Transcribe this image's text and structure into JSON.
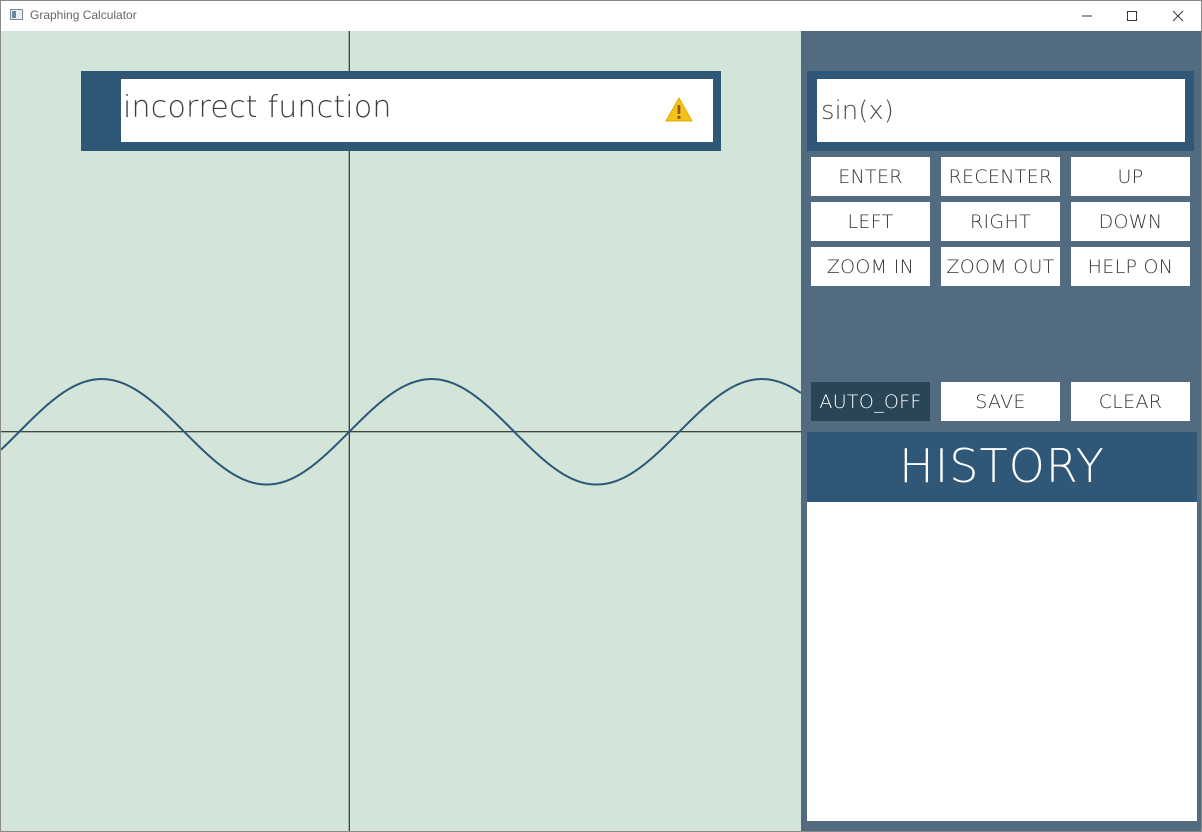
{
  "window": {
    "title": "Graphing Calculator",
    "controls": [
      "minimize",
      "maximize",
      "close"
    ]
  },
  "error": {
    "message": "incorrect function",
    "icon": "warning-icon"
  },
  "function_input": {
    "value": "sin(x)"
  },
  "buttons": {
    "enter": "ENTER",
    "recenter": "RECENTER",
    "up": "UP",
    "left": "LEFT",
    "right": "RIGHT",
    "down": "DOWN",
    "zoom_in": "ZOOM IN",
    "zoom_out": "ZOOM OUT",
    "help": "HELP ON",
    "auto": "AUTO_OFF",
    "save": "SAVE",
    "clear": "CLEAR"
  },
  "history": {
    "title": "HISTORY",
    "items": []
  },
  "colors": {
    "graph_background": "#d3e5d8",
    "curve": "#2d5678",
    "side_panel": "#536b80",
    "accent": "#2f5878",
    "auto_button": "#2a4556"
  },
  "chart_data": {
    "type": "line",
    "series": [
      {
        "function": "sin(x)"
      }
    ],
    "xlim": [
      -6.63,
      8.6
    ],
    "ylim": [
      -7.57,
      7.6
    ],
    "grid": false
  }
}
